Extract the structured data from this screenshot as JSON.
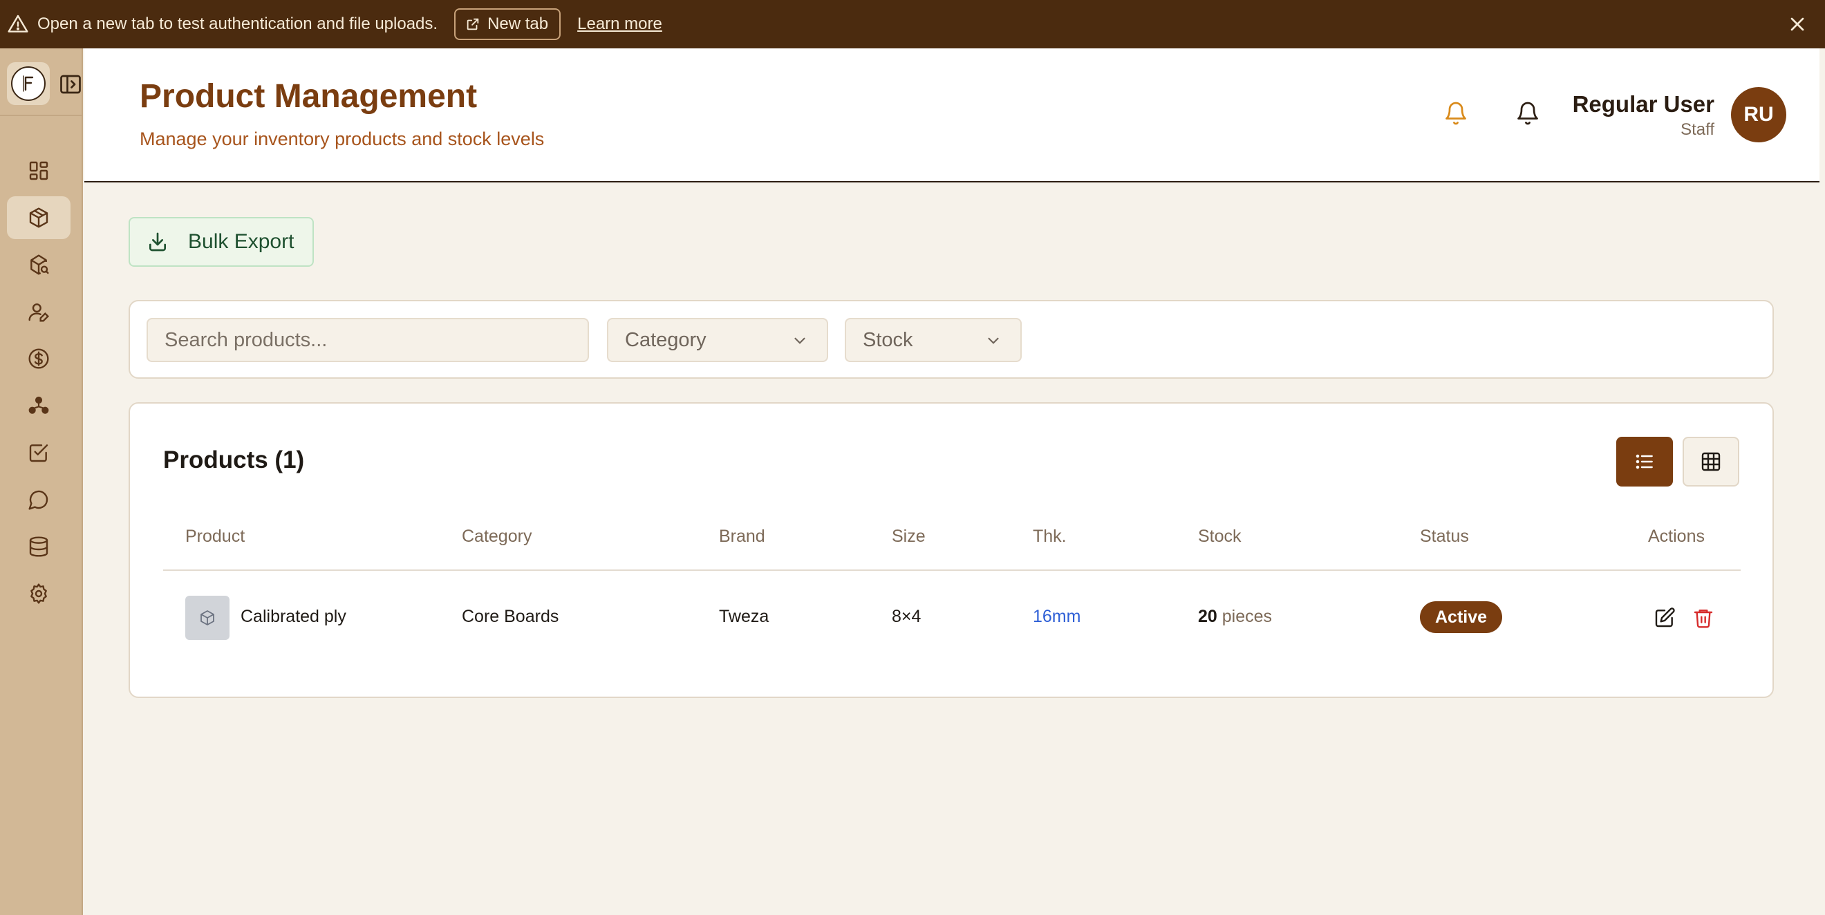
{
  "banner": {
    "icon": "warning-triangle-icon",
    "message": "Open a new tab to test authentication and file uploads.",
    "new_tab_label": "New tab",
    "learn_more_label": "Learn more",
    "background": "#4b2b0f"
  },
  "sidebar": {
    "logo_letter": "F",
    "items": [
      {
        "icon": "dashboard-icon",
        "active": false
      },
      {
        "icon": "package-icon",
        "active": true
      },
      {
        "icon": "package-search-icon",
        "active": false
      },
      {
        "icon": "user-edit-icon",
        "active": false
      },
      {
        "icon": "dollar-circle-icon",
        "active": false
      },
      {
        "icon": "network-icon",
        "active": false
      },
      {
        "icon": "checkbox-icon",
        "active": false
      },
      {
        "icon": "chat-icon",
        "active": false
      },
      {
        "icon": "database-icon",
        "active": false
      },
      {
        "icon": "settings-icon",
        "active": false
      }
    ]
  },
  "header": {
    "title": "Product Management",
    "subtitle": "Manage your inventory products and stock levels",
    "user_name": "Regular User",
    "user_role": "Staff",
    "avatar_initials": "RU"
  },
  "toolbar": {
    "bulk_export_label": "Bulk Export"
  },
  "filters": {
    "search_placeholder": "Search products...",
    "category_label": "Category",
    "stock_label": "Stock"
  },
  "products": {
    "title": "Products (1)",
    "columns": [
      "Product",
      "Category",
      "Brand",
      "Size",
      "Thk.",
      "Stock",
      "Status",
      "Actions"
    ],
    "rows": [
      {
        "product": "Calibrated ply",
        "category": "Core Boards",
        "brand": "Tweza",
        "size": "8×4",
        "thickness": "16mm",
        "stock_qty": "20",
        "stock_unit": "pieces",
        "status": "Active"
      }
    ]
  },
  "colors": {
    "accent": "#7a3d10",
    "title": "#7a3d10",
    "subtitle": "#a7541c",
    "thickness_link": "#2e5fd6",
    "delete": "#d62b2b"
  }
}
